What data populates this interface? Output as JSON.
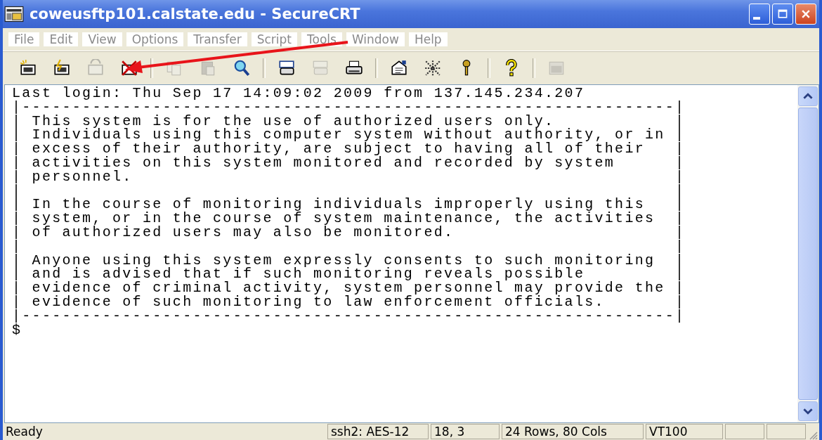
{
  "window": {
    "title": "coweusftp101.calstate.edu - SecureCRT"
  },
  "menu": [
    "File",
    "Edit",
    "View",
    "Options",
    "Transfer",
    "Script",
    "Tools",
    "Window",
    "Help"
  ],
  "toolbar": [
    {
      "kind": "connect",
      "disabled": false
    },
    {
      "kind": "quick",
      "disabled": false
    },
    {
      "kind": "reconnect",
      "disabled": true
    },
    {
      "kind": "disconnect",
      "disabled": false
    },
    {
      "kind": "sep"
    },
    {
      "kind": "copy",
      "disabled": true
    },
    {
      "kind": "paste",
      "disabled": true
    },
    {
      "kind": "find",
      "disabled": false
    },
    {
      "kind": "sep"
    },
    {
      "kind": "print-setup",
      "disabled": false
    },
    {
      "kind": "print-selection",
      "disabled": true
    },
    {
      "kind": "print",
      "disabled": false
    },
    {
      "kind": "sep"
    },
    {
      "kind": "session-options",
      "disabled": false
    },
    {
      "kind": "global-options",
      "disabled": false
    },
    {
      "kind": "key",
      "disabled": false
    },
    {
      "kind": "sep"
    },
    {
      "kind": "help",
      "disabled": false
    },
    {
      "kind": "sep"
    },
    {
      "kind": "sftp",
      "disabled": true
    }
  ],
  "terminal": {
    "lines": [
      "Last login: Thu Sep 17 14:09:02 2009 from 137.145.234.207",
      "|-----------------------------------------------------------------|",
      "| This system is for the use of authorized users only.            |",
      "| Individuals using this computer system without authority, or in |",
      "| excess of their authority, are subject to having all of their   |",
      "| activities on this system monitored and recorded by system      |",
      "| personnel.                                                      |",
      "|                                                                 |",
      "| In the course of monitoring individuals improperly using this   |",
      "| system, or in the course of system maintenance, the activities  |",
      "| of authorized users may also be monitored.                      |",
      "|                                                                 |",
      "| Anyone using this system expressly consents to such monitoring  |",
      "| and is advised that if such monitoring reveals possible         |",
      "| evidence of criminal activity, system personnel may provide the |",
      "| evidence of such monitoring to law enforcement officials.       |",
      "|-----------------------------------------------------------------|",
      "$"
    ]
  },
  "status_bar": {
    "message": "Ready",
    "panels": [
      "ssh2: AES-12",
      "18,  3",
      "24 Rows,  80 Cols",
      "VT100"
    ]
  }
}
